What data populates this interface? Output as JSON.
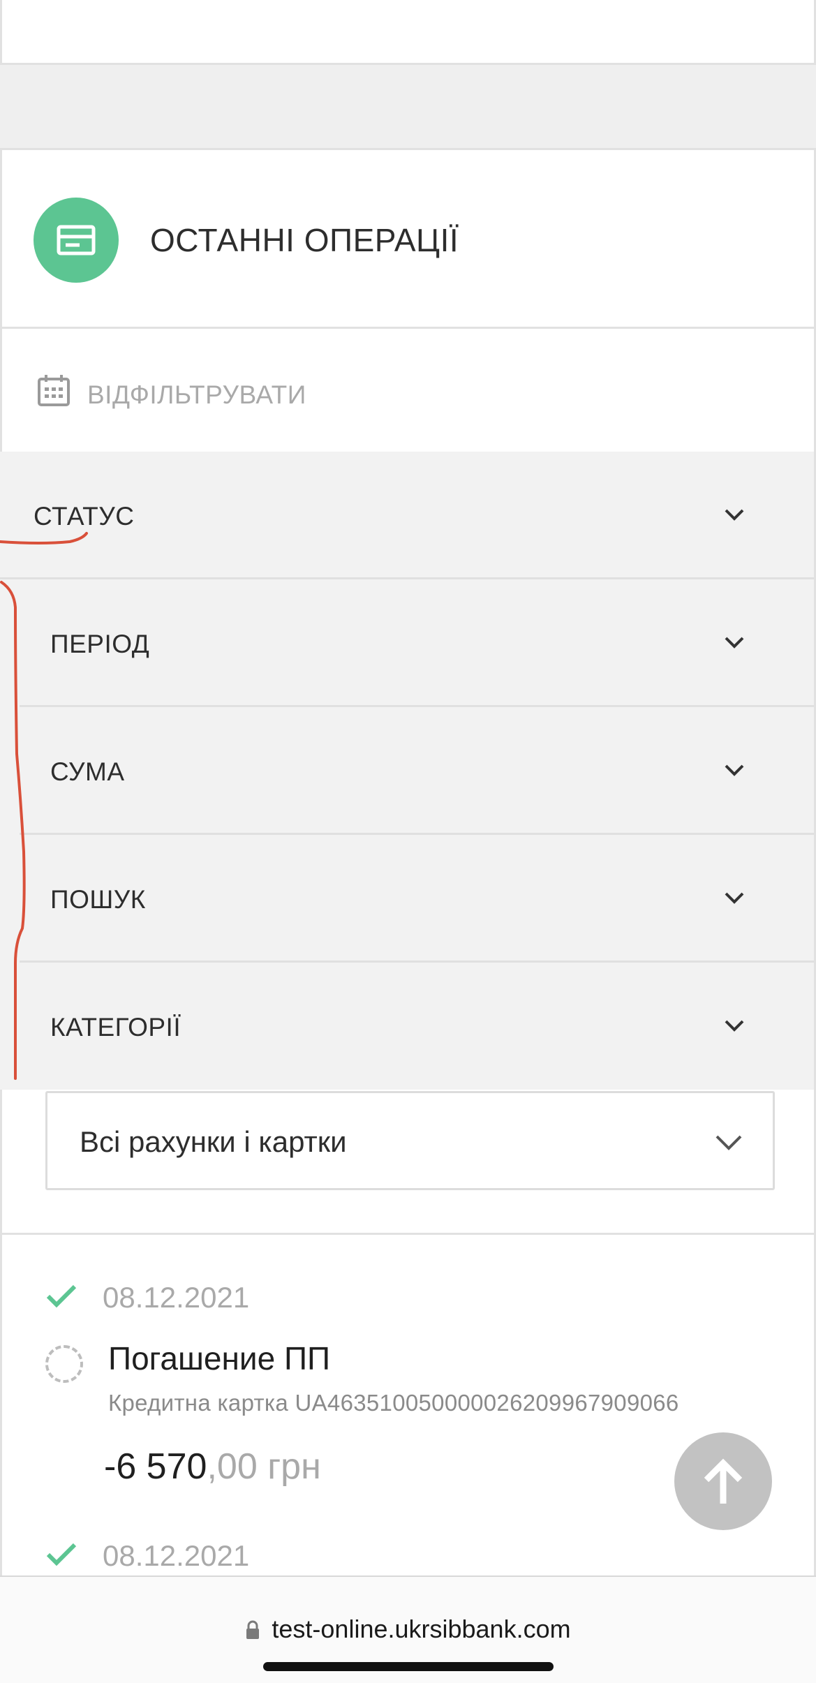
{
  "recent_ops": {
    "title": "ОСТАННІ ОПЕРАЦІЇ",
    "icon": "card-icon",
    "accent": "#5cc592"
  },
  "filter": {
    "label": "ВІДФІЛЬТРУВАТИ",
    "icon": "calendar-icon"
  },
  "accordion": [
    {
      "label": "СТАТУС"
    },
    {
      "label": "ПЕРІОД"
    },
    {
      "label": "СУМА"
    },
    {
      "label": "ПОШУК"
    },
    {
      "label": "КАТЕГОРІЇ"
    }
  ],
  "account_select": {
    "value": "Всі рахунки і картки"
  },
  "transactions": [
    {
      "date": "08.12.2021",
      "title": "Погашение ПП",
      "account": "Кредитна картка UA463510050000026209967909066",
      "amount_int": "-6 570",
      "amount_dec": ",00 грн"
    },
    {
      "date": "08.12.2021"
    }
  ],
  "browser": {
    "url": "test-online.ukrsibbank.com"
  },
  "annotation_color": "#d9503a"
}
